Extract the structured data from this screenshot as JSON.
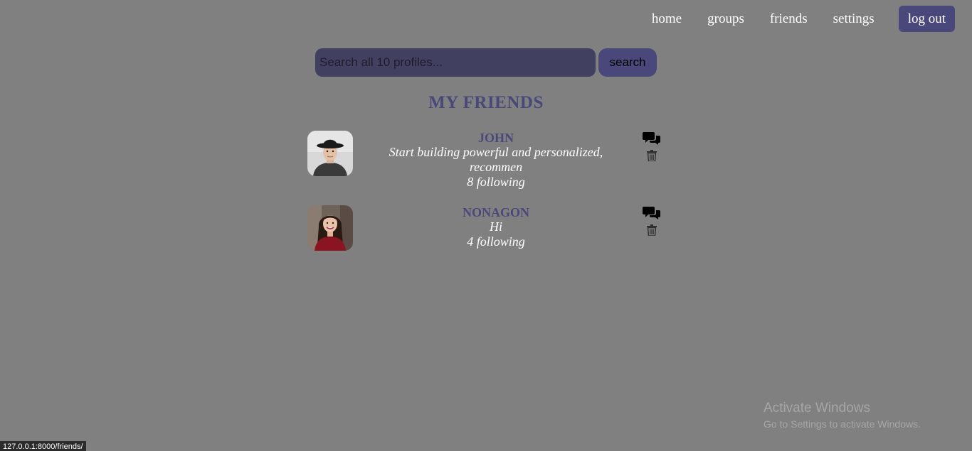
{
  "nav": {
    "items": [
      {
        "label": "home"
      },
      {
        "label": "groups"
      },
      {
        "label": "friends"
      },
      {
        "label": "settings"
      }
    ],
    "logout_label": "log out"
  },
  "search": {
    "placeholder": "Search all 10 profiles...",
    "value": "",
    "button_label": "search"
  },
  "page": {
    "title": "MY FRIENDS"
  },
  "friends": [
    {
      "name": "JOHN",
      "bio_line1": "Start building powerful and personalized,",
      "bio_line2": "recommen",
      "following": "8 following",
      "icons": [
        "chat-icon",
        "trash-icon"
      ]
    },
    {
      "name": "NONAGON",
      "bio_line1": "Hi",
      "following": "4 following",
      "icons": [
        "chat-icon",
        "trash-icon"
      ]
    }
  ],
  "watermark": {
    "title": "Activate Windows",
    "subtitle": "Go to Settings to activate Windows."
  },
  "status_url": "127.0.0.1:8000/friends/",
  "colors": {
    "background": "#808080",
    "accent": "#4a487a",
    "input_bg": "#424060",
    "text_light": "#ffffff"
  }
}
